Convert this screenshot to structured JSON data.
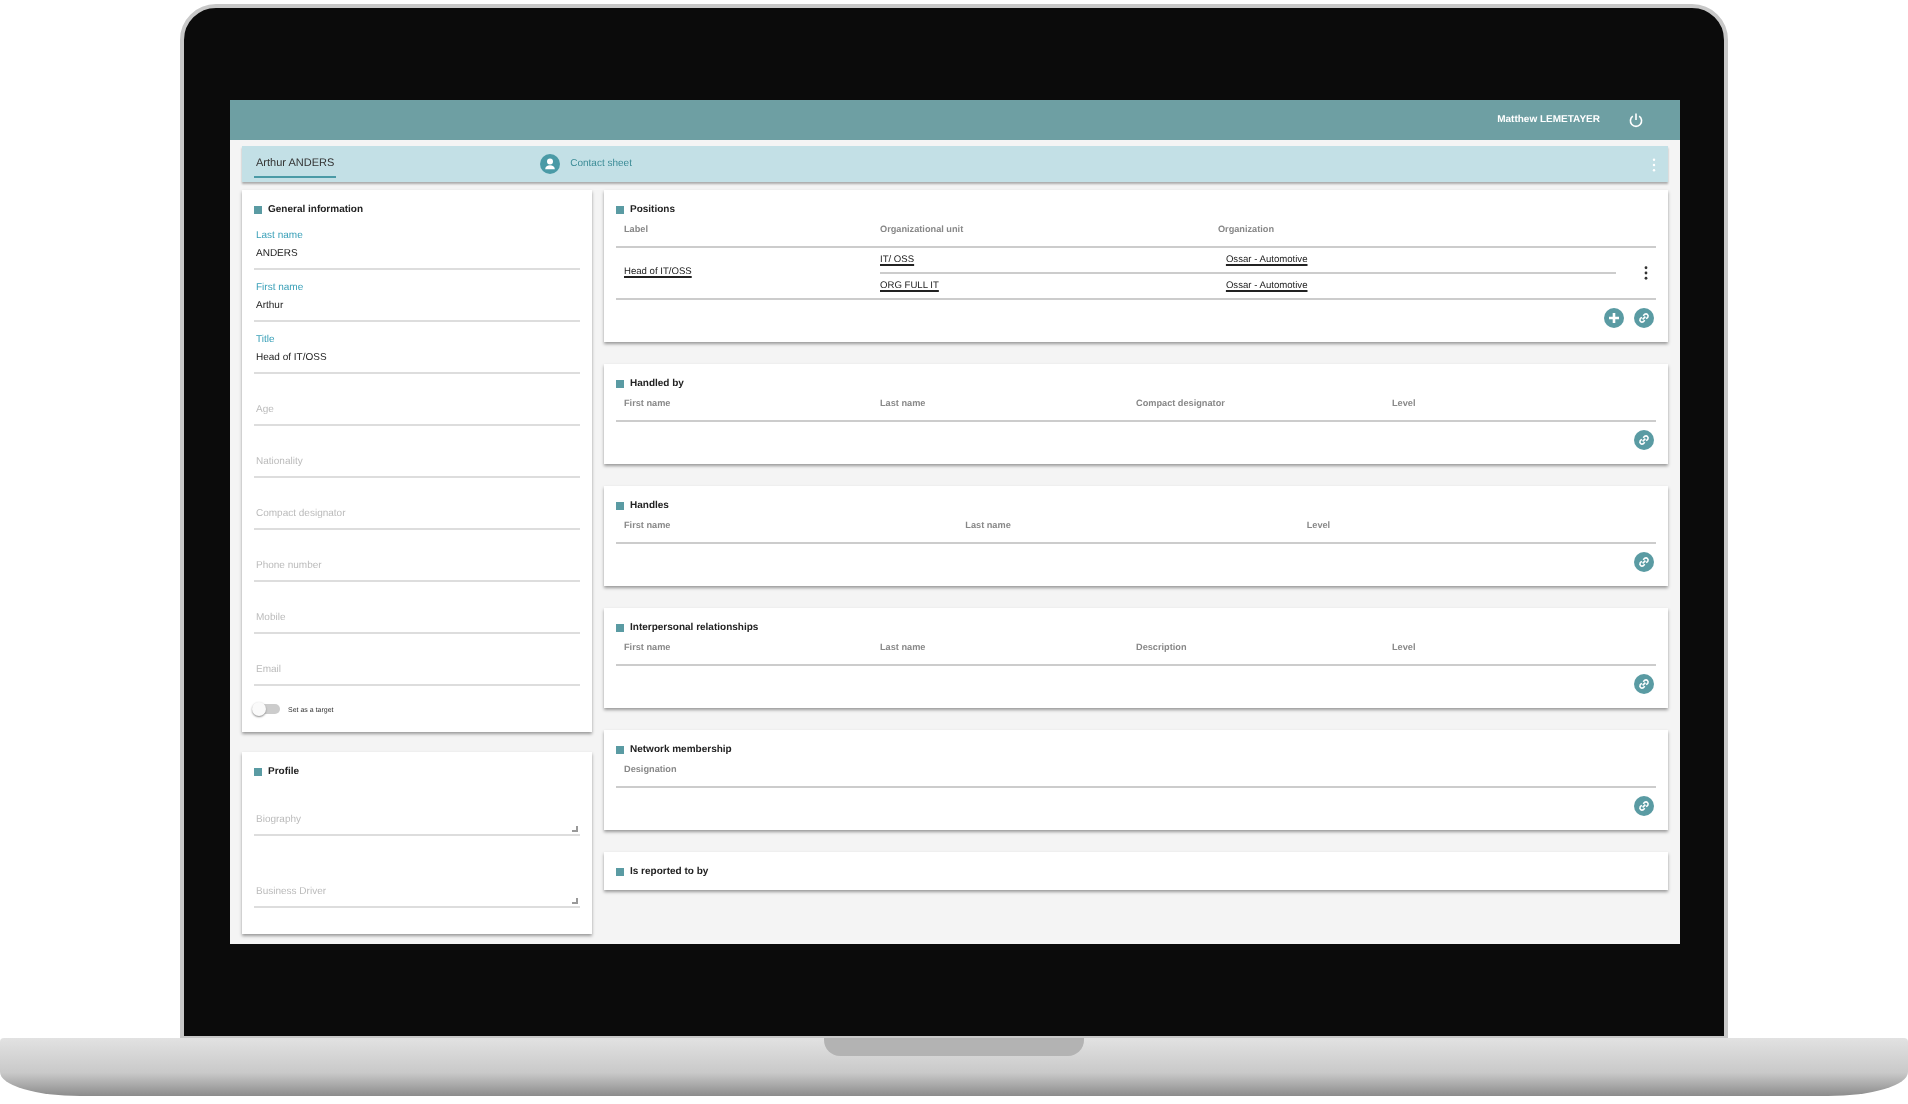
{
  "header": {
    "user": "Matthew LEMETAYER"
  },
  "tabs": [
    {
      "label": "Arthur ANDERS",
      "selected": true
    }
  ],
  "context": {
    "label": "Contact sheet"
  },
  "general": {
    "title": "General information",
    "fields": [
      {
        "label": "Last name",
        "value": "ANDERS"
      },
      {
        "label": "First name",
        "value": "Arthur"
      },
      {
        "label": "Title",
        "value": "Head of IT/OSS"
      },
      {
        "placeholder": "Age"
      },
      {
        "placeholder": "Nationality"
      },
      {
        "placeholder": "Compact designator"
      },
      {
        "placeholder": "Phone number"
      },
      {
        "placeholder": "Mobile"
      },
      {
        "placeholder": "Email"
      }
    ],
    "toggle": {
      "label": "Set as a target",
      "on": false
    }
  },
  "profile": {
    "title": "Profile",
    "fields": [
      {
        "placeholder": "Biography"
      },
      {
        "placeholder": "Business Driver"
      }
    ]
  },
  "sections": [
    {
      "kind": "positions",
      "title": "Positions",
      "columns": [
        "Label",
        "Organizational unit",
        "Organization"
      ],
      "rows": [
        {
          "label": "Head of IT/OSS",
          "menu": true,
          "units": [
            {
              "unit": "IT/ OSS",
              "organization": "Ossar - Automotive"
            },
            {
              "unit": "ORG FULL IT",
              "organization": "Ossar - Automotive"
            }
          ]
        }
      ],
      "add": true,
      "link": true
    },
    {
      "kind": "table",
      "title": "Handled by",
      "columns": [
        "First name",
        "Last name",
        "Compact designator",
        "Level"
      ],
      "link": true
    },
    {
      "kind": "table",
      "title": "Handles",
      "columns": [
        "First name",
        "Last name",
        "Level"
      ],
      "link": true
    },
    {
      "kind": "table",
      "title": "Interpersonal relationships",
      "columns": [
        "First name",
        "Last name",
        "Description",
        "Level"
      ],
      "link": true
    },
    {
      "kind": "table",
      "title": "Network membership",
      "columns": [
        "Designation"
      ],
      "link": true
    },
    {
      "kind": "table",
      "title": "Is reported to by"
    }
  ]
}
